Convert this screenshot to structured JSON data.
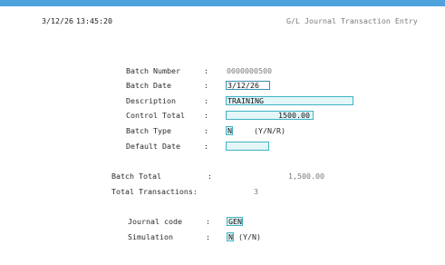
{
  "header": {
    "date": "3/12/26",
    "time": "13:45:20",
    "title": "G/L Journal Transaction Entry"
  },
  "batch": {
    "batch_number_label": "Batch Number",
    "batch_number_value": "0000000500",
    "batch_date_label": "Batch Date",
    "batch_date_value": "3/12/26",
    "description_label": "Description",
    "description_value": "TRAINING",
    "control_total_label": "Control Total",
    "control_total_value": "1500.00",
    "batch_type_label": "Batch Type",
    "batch_type_value": "N",
    "batch_type_hint": "(Y/N/R)",
    "default_date_label": "Default Date",
    "default_date_value": ""
  },
  "totals": {
    "batch_total_label": "Batch Total",
    "batch_total_value": "1,500.00",
    "total_transactions_label": "Total Transactions:",
    "total_transactions_value": "3"
  },
  "journal": {
    "journal_code_label": "Journal code",
    "journal_code_value": "GEN",
    "simulation_label": "Simulation",
    "simulation_value": "N",
    "simulation_hint": "(Y/N)"
  },
  "colon": ":",
  "colors": {
    "top_bar": "#4ea3dc",
    "field_border": "#3fb3c4",
    "field_fill": "#e4f6f8"
  }
}
